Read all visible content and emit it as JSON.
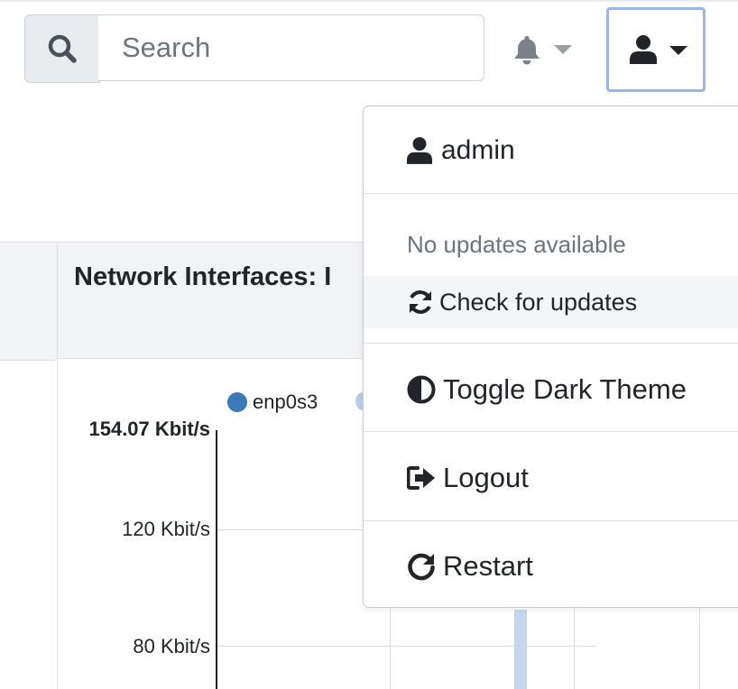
{
  "search": {
    "placeholder": "Search"
  },
  "header": {
    "notifications_icon": "bell-icon",
    "user_menu_icon": "user-icon"
  },
  "card": {
    "title": "Network Interfaces: I"
  },
  "chart_data": {
    "type": "bar",
    "legend": [
      "enp0s3",
      ""
    ],
    "y_tick_labels": [
      "154.07 Kbit/s",
      "120 Kbit/s",
      "80 Kbit/s"
    ],
    "y_max_label": "154.07 Kbit/s",
    "series": [
      {
        "name": "enp0s3",
        "color": "#3a7ab8"
      },
      {
        "color": "#b9cde8"
      }
    ],
    "ylim": [
      0,
      154.07
    ],
    "yunit": "Kbit/s"
  },
  "user_menu": {
    "username": "admin",
    "update_status": "No updates available",
    "check_updates": "Check for updates",
    "toggle_theme": "Toggle Dark Theme",
    "logout": "Logout",
    "restart": "Restart"
  },
  "colors": {
    "accent_focus": "#9bb5ec",
    "series_primary": "#3a7ab8",
    "series_secondary": "#b9cde8"
  }
}
